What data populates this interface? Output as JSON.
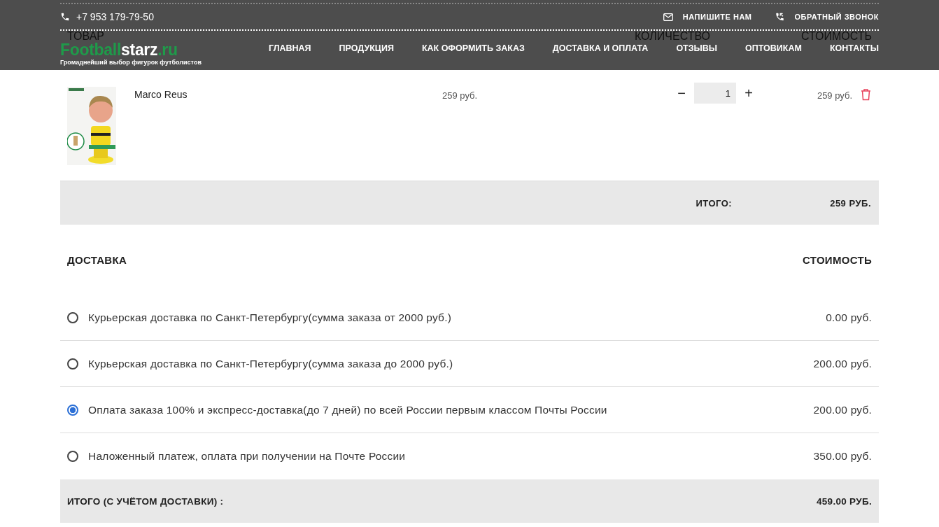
{
  "header": {
    "phone": "+7 953 179-79-50",
    "links": [
      "НАПИШИТЕ НАМ",
      "ОБРАТНЫЙ ЗВОНОК"
    ],
    "logo": {
      "green": "Football",
      "white": "starz",
      "ending": ".ru"
    },
    "tagline": "Громаднейший выбор фигурок футболистов",
    "nav": [
      "ГЛАВНАЯ",
      "ПРОДУКЦИЯ",
      "КАК ОФОРМИТЬ ЗАКАЗ",
      "ДОСТАВКА И ОПЛАТА",
      "ОТЗЫВЫ",
      "ОПТОВИКАМ",
      "КОНТАКТЫ"
    ]
  },
  "cart": {
    "columns": [
      "ТОВАР",
      "КОЛИЧЕСТВО",
      "СТОИМОСТЬ"
    ],
    "items": [
      {
        "name": "Marco Reus",
        "price": "259 руб.",
        "quantity": "1",
        "minus": "−",
        "plus": "+",
        "total": "259 руб."
      }
    ],
    "total_label": "ИТОГО:",
    "total": "259 РУБ."
  },
  "delivery": {
    "title": "ДОСТАВКА",
    "cost_title": "СТОИМОСТЬ",
    "options": [
      {
        "label": "Курьерская доставка по Санкт-Петербургу(сумма заказа от 2000 руб.)",
        "cost": "0.00 руб.",
        "selected": false
      },
      {
        "label": "Курьерская доставка по Санкт-Петербургу(сумма заказа до 2000 руб.)",
        "cost": "200.00 руб.",
        "selected": false
      },
      {
        "label": "Оплата заказа 100% и экспресс-доставка(до 7 дней) по всей России первым классом Почты России",
        "cost": "200.00 руб.",
        "selected": true
      },
      {
        "label": "Наложенный платеж, оплата при получении на Почте России",
        "cost": "350.00 руб.",
        "selected": false
      }
    ],
    "total_label": "ИТОГО (С УЧЁТОМ ДОСТАВКИ) :",
    "total": "459.00 РУБ."
  }
}
